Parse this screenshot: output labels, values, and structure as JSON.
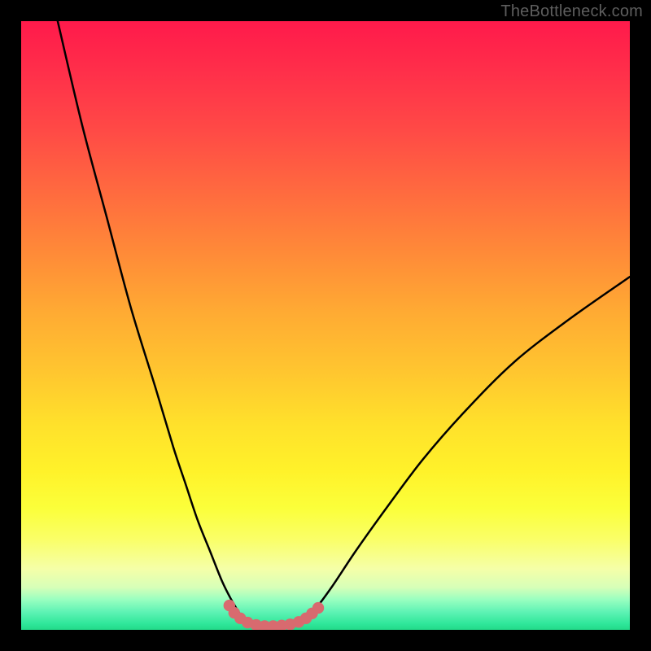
{
  "watermark": "TheBottleneck.com",
  "colors": {
    "background": "#000000",
    "curve": "#000000",
    "marker": "#d86a6f",
    "gradient_top": "#ff1a4b",
    "gradient_bottom": "#23d989"
  },
  "chart_data": {
    "type": "line",
    "title": "",
    "xlabel": "",
    "ylabel": "",
    "xlim": [
      0,
      100
    ],
    "ylim": [
      0,
      100
    ],
    "grid": false,
    "legend": null,
    "series": [
      {
        "name": "left-curve",
        "x": [
          6,
          10,
          14,
          18,
          22,
          25,
          27,
          29,
          31,
          33,
          34.5,
          36,
          37
        ],
        "values": [
          100,
          83,
          68,
          53,
          40,
          30,
          24,
          18,
          13,
          8,
          5,
          2.5,
          1
        ]
      },
      {
        "name": "right-curve",
        "x": [
          46,
          48,
          51,
          55,
          60,
          66,
          73,
          81,
          90,
          100
        ],
        "values": [
          1,
          3,
          7,
          13,
          20,
          28,
          36,
          44,
          51,
          58
        ]
      },
      {
        "name": "bottom-flat",
        "x": [
          37,
          39,
          41,
          43,
          45,
          46
        ],
        "values": [
          1,
          0.6,
          0.5,
          0.5,
          0.7,
          1
        ]
      }
    ],
    "markers": {
      "name": "valley-dots",
      "x": [
        34.2,
        35.0,
        36.0,
        37.2,
        38.6,
        40.0,
        41.4,
        42.8,
        44.2,
        45.6,
        46.8,
        47.8,
        48.8
      ],
      "values": [
        4.0,
        2.8,
        1.9,
        1.2,
        0.8,
        0.6,
        0.6,
        0.7,
        0.9,
        1.3,
        1.9,
        2.7,
        3.6
      ]
    },
    "annotations": []
  }
}
